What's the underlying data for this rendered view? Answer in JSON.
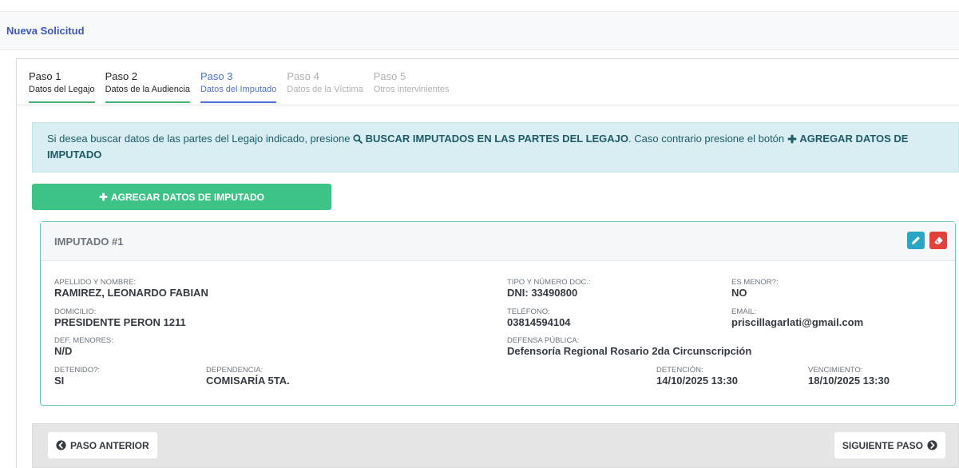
{
  "header": {
    "title": "Nueva Solicitud"
  },
  "steps": [
    {
      "num": "Paso 1",
      "label": "Datos del Legajo",
      "state": "done"
    },
    {
      "num": "Paso 2",
      "label": "Datos de la Audiencia",
      "state": "done"
    },
    {
      "num": "Paso 3",
      "label": "Datos del Imputado",
      "state": "active"
    },
    {
      "num": "Paso 4",
      "label": "Datos de la Víctima",
      "state": "pending"
    },
    {
      "num": "Paso 5",
      "label": "Otros intervinientes",
      "state": "pending"
    }
  ],
  "info": {
    "text1": "Si desea buscar datos de las partes del Legajo indicado, presione ",
    "search_label": "BUSCAR IMPUTADOS EN LAS PARTES DEL LEGAJO",
    "text2": ". Caso contrario presione el botón ",
    "add_label": "AGREGAR DATOS DE IMPUTADO"
  },
  "add_button": {
    "label": "AGREGAR DATOS DE IMPUTADO"
  },
  "imputado": {
    "title": "IMPUTADO #1",
    "apellido_nombre": {
      "label": "APELLIDO Y NOMBRE:",
      "value": "RAMIREZ, LEONARDO FABIAN"
    },
    "tipo_doc": {
      "label": "TIPO Y NÚMERO DOC.:",
      "value": "DNI: 33490800"
    },
    "es_menor": {
      "label": "ES MENOR?:",
      "value": "NO"
    },
    "domicilio": {
      "label": "DOMICILIO:",
      "value": "PRESIDENTE PERON 1211"
    },
    "telefono": {
      "label": "TELÉFONO:",
      "value": "03814594104"
    },
    "email": {
      "label": "EMAIL:",
      "value": "priscillagarlati@gmail.com"
    },
    "def_menores": {
      "label": "DEF. MENORES:",
      "value": "N/D"
    },
    "defensa_publica": {
      "label": "DEFENSA PÚBLICA:",
      "value": "Defensoría Regional Rosario 2da Circunscripción"
    },
    "detenido": {
      "label": "DETENIDO?:",
      "value": "SI"
    },
    "dependencia": {
      "label": "DEPENDENCIA:",
      "value": "COMISARÍA 5TA."
    },
    "detencion": {
      "label": "DETENCIÓN:",
      "value": "14/10/2025 13:30"
    },
    "vencimiento": {
      "label": "VENCIMIENTO:",
      "value": "18/10/2025 13:30"
    }
  },
  "footer": {
    "prev_label": "PASO ANTERIOR",
    "next_label": "SIGUIENTE PASO"
  },
  "colors": {
    "accent": "#3b57c6",
    "success": "#3ec386",
    "info_bg": "#d8eef2",
    "danger": "#e0413b",
    "edit": "#2aa6c4"
  }
}
